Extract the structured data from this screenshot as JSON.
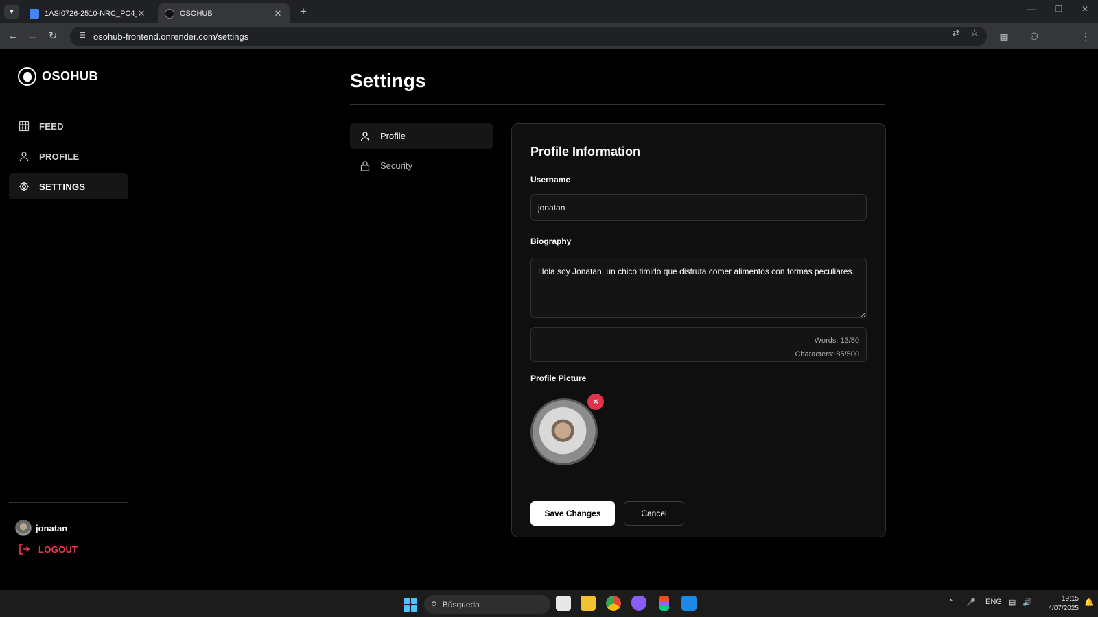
{
  "browser": {
    "tabs": [
      {
        "title": "1ASI0726-2510-NRC_PC4_Infor",
        "active": false
      },
      {
        "title": "OSOHUB",
        "active": true
      }
    ],
    "url": "osohub-frontend.onrender.com/settings"
  },
  "sidebar": {
    "brand": "OSOHUB",
    "items": [
      {
        "label": "FEED",
        "icon": "grid-icon"
      },
      {
        "label": "PROFILE",
        "icon": "user-icon"
      },
      {
        "label": "SETTINGS",
        "icon": "gear-icon",
        "active": true
      }
    ],
    "user": {
      "name": "jonatan"
    },
    "logout_label": "LOGOUT"
  },
  "page": {
    "title": "Settings",
    "settings_nav": [
      {
        "label": "Profile",
        "icon": "user-icon",
        "active": true
      },
      {
        "label": "Security",
        "icon": "lock-icon",
        "active": false
      }
    ]
  },
  "profile_card": {
    "title": "Profile Information",
    "username_label": "Username",
    "username_value": "jonatan",
    "biography_label": "Biography",
    "biography_value": "Hola soy Jonatan, un chico timido que disfruta comer alimentos con formas peculiares.",
    "words_counter": "Words: 13/50",
    "characters_counter": "Characters: 85/500",
    "picture_label": "Profile Picture",
    "remove_icon": "×",
    "save_label": "Save Changes",
    "cancel_label": "Cancel"
  },
  "taskbar": {
    "search_placeholder": "Búsqueda",
    "language": "ENG",
    "time": "19:15",
    "date": "4/07/2025"
  },
  "colors": {
    "accent_danger": "#f0384d",
    "remove_button": "#e0334a",
    "background": "#000000",
    "card": "#0f0f0f"
  }
}
